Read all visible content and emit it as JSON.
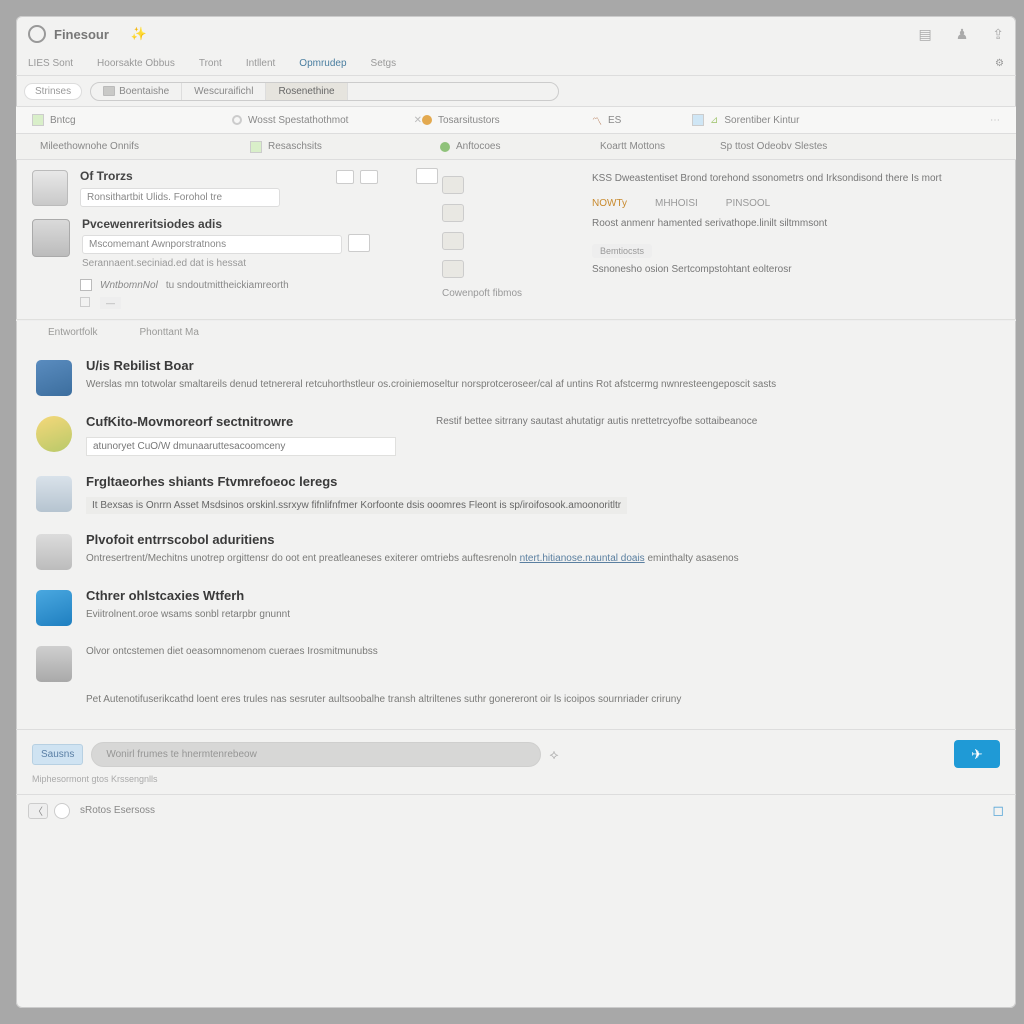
{
  "titlebar": {
    "app_name": "Finesour"
  },
  "tabs": {
    "t0": "LIES Sont",
    "t1": "Hoorsakte Obbus",
    "t2": "Tront",
    "t3": "Intllent",
    "t4": "Opmrudep",
    "t5": "Setgs"
  },
  "filter": {
    "tag": "Strinses",
    "p0": "Boentaishe",
    "p1": "Wescuraifichl",
    "p2": "Rosenethine"
  },
  "colheads": {
    "c0": "Bntcg",
    "c1": "Wosst Spestathothmot",
    "c2": "Tosarsitustors",
    "c3": "ES",
    "c4": "Sorentiber Kintur"
  },
  "subheads": {
    "s0": "Mileethownohe Onnifs",
    "s1": "Resaschsits",
    "s2": "Anftocoes",
    "s3": "Koartt Mottons",
    "s4": "Sp ttost Odeobv Slestes"
  },
  "upper_left": {
    "b0_title": "Of Trorzs",
    "b0_input": "Ronsithartbit Ulids. Forohol tre",
    "b1_title": "Pvcewenreritsiodes adis",
    "b1_sub": "Mscomemant Awnporstratnons",
    "b1_note": "Serannaent.seciniad.ed dat is hessat",
    "b2_check": "WntbomnNol",
    "b2_label": "tu sndoutmittheickiamreorth",
    "bar_a": "Entwortfolk",
    "bar_b": "Phonttant Ma"
  },
  "upper_right": {
    "desc": "KSS Dweastentiset Brond torehond ssonometrs ond Irksondisond there Is mort",
    "tab_on": "NOWTy",
    "tab_o1": "MHHOISI",
    "tab_o2": "PINSOOL",
    "line1": "Roost anmenr hamented serivathope.linilt siltmmsont",
    "badge": "Bemtiocsts",
    "line2": "Ssnonesho osion Sertcompstohtant eolterosr",
    "caption": "Cowenpoft fibmos"
  },
  "sections": {
    "s0": {
      "title": "U/is Rebilist Boar",
      "body": "Werslas mn totwolar smaltareils denud tetnereral retcuhorthstleur os.croiniemoseltur norsprotceroseer/cal af untins Rot afstcermg nwnresteengeposcit sasts"
    },
    "s1": {
      "title": "CufKito-Movmoreorf sectnitrowre",
      "hl": "atunoryet CuO/W dmunaaruttesacoomceny",
      "side": "Restif bettee sitrrany sautast ahutatigr autis nrettetrcyofbe sottaibeanoce"
    },
    "s2": {
      "title": "Frgltaeorhes shiants Ftvmrefoeoc leregs",
      "hl": "It Bexsas is Onrrn Asset Msdsinos orskinl.ssrxyw fifnlifnfmer Korfoonte dsis ooomres Fleont is sp/iroifosook.amoonoritltr"
    },
    "s3": {
      "title": "Plvofoit entrrscobol aduritiens",
      "body": "Ontresertrent/Mechitns unotrep orgittensr do oot ent preatleaneses exiterer omtriebs auftesrenoln ntert.hitianose.nauntal doais eminthalty asasenos",
      "link": "ntert.hitianose.nauntal doais"
    },
    "s4": {
      "title": "Cthrer ohlstcaxies Wtferh",
      "body": "Eviitrolnent.oroe wsams sonbl retarpbr gnunnt"
    },
    "s5": {
      "body": "Olvor ontcstemen diet oeasomnomenom cueraes Irosmitmunubss"
    },
    "s6": {
      "body": "Pet Autenotifuserikcathd loent eres trules nas sesruter aultsoobalhe transh altriltenes suthr gonereront oir ls icoipos sournriader criruny"
    }
  },
  "bottom": {
    "tag": "Sausns",
    "placeholder": "Wonirl frumes te hnermtenrebeow",
    "hint": "Miphesormont gtos Krssengnlls"
  },
  "status": {
    "text": "sRotos Esersoss"
  }
}
